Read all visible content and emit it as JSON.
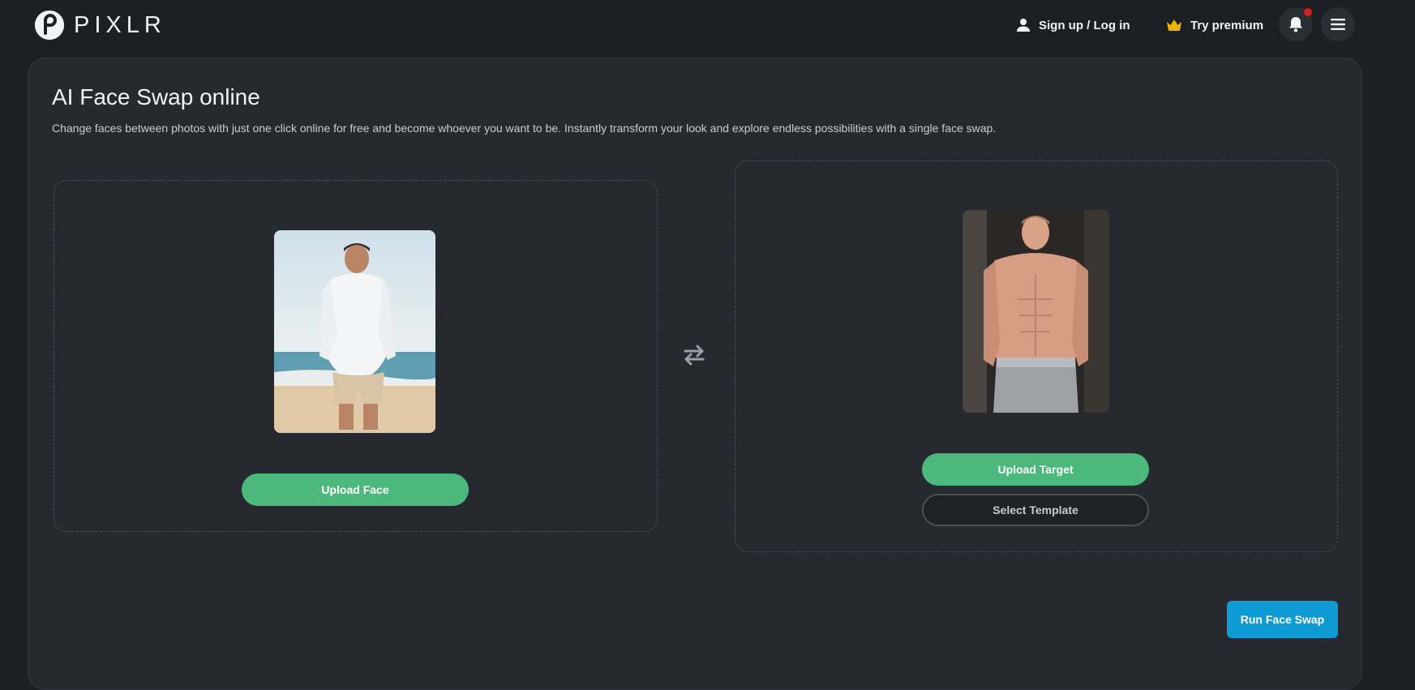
{
  "header": {
    "logo_text": "PIXLR",
    "signup_label": "Sign up / Log in",
    "premium_label": "Try premium",
    "icons": {
      "logo": "pixlr-logo-icon",
      "user": "user-icon",
      "crown": "crown-icon",
      "bell": "bell-icon",
      "menu": "hamburger-menu-icon"
    },
    "colors": {
      "crown": "#f0b400",
      "notification_dot": "#d61f1f"
    }
  },
  "main": {
    "title": "AI Face Swap online",
    "description": "Change faces between photos with just one click online for free and become whoever you want to be. Instantly transform your look and explore endless possibilities with a single face swap.",
    "face_panel": {
      "upload_label": "Upload Face"
    },
    "target_panel": {
      "upload_label": "Upload Target",
      "template_label": "Select Template"
    },
    "swap_icon": "swap-arrows-icon",
    "run_label": "Run Face Swap",
    "colors": {
      "upload": "#4cb87c",
      "run": "#0e9ad3"
    }
  }
}
